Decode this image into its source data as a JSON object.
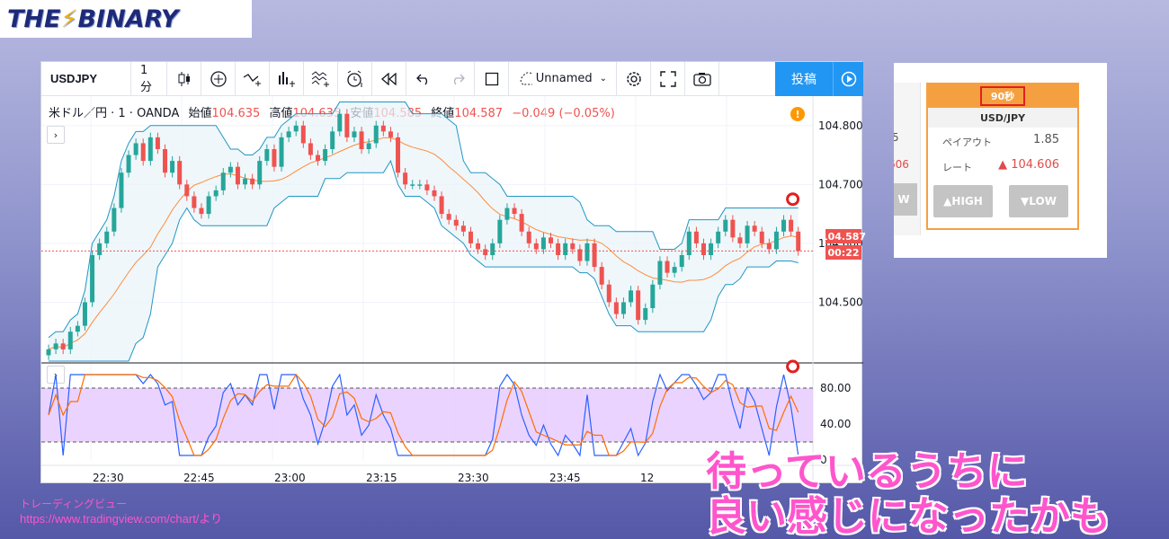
{
  "logo": {
    "text_a": "THE",
    "text_b": "BINARY"
  },
  "toolbar": {
    "symbol": "USDJPY",
    "interval": "1分",
    "layout_name": "Unnamed",
    "publish_label": "投稿"
  },
  "legend": {
    "title": "米ドル／円 · 1 · OANDA",
    "open_label": "始値",
    "open": "104.635",
    "high_label": "高値",
    "high": "104.635",
    "low_label": "安値",
    "low": "104.585",
    "close_label": "終値",
    "close": "104.587",
    "change": "−0.049 (−0.05%)"
  },
  "price_axis": {
    "labels": [
      "104.800",
      "104.700",
      "104.600",
      "104.500"
    ],
    "current_price": "104.587",
    "countdown": "00:22"
  },
  "osc_axis": {
    "labels": [
      "80.00",
      "40.00",
      "0"
    ]
  },
  "time_axis": {
    "labels": [
      "22:30",
      "22:45",
      "23:00",
      "23:15",
      "23:30",
      "23:45",
      "12"
    ]
  },
  "colors": {
    "up": "#26a69a",
    "down": "#ef5350",
    "band": "#2196c4",
    "basis": "#ff8c3a",
    "osc_fill": "#e6c8ff",
    "accent": "#2196f3",
    "caption": "#ff55cc",
    "widget_orange": "#f5a040"
  },
  "widget": {
    "timer": "90秒",
    "pair": "USD/JPY",
    "payout_label": "ペイアウト",
    "payout": "1.85",
    "rate_label": "レート",
    "rate": "▲ 104.606",
    "high_btn": "▲HIGH",
    "low_btn": "▼LOW",
    "partial_payout": "5",
    "partial_rate": "606",
    "partial_btn": "W"
  },
  "caption": {
    "line1": "待っているうちに",
    "line2": "良い感じになったかも"
  },
  "credit": {
    "line1": "トレーディングビュー",
    "line2": "https://www.tradingview.com/chart/より"
  },
  "chart_data": {
    "type": "candlestick",
    "symbol": "USDJPY",
    "interval": "1",
    "y_range": [
      104.4,
      104.85
    ],
    "x_ticks": [
      "22:30",
      "22:45",
      "23:00",
      "23:15",
      "23:30",
      "23:45",
      "12"
    ],
    "closes": [
      104.42,
      104.43,
      104.42,
      104.45,
      104.46,
      104.5,
      104.58,
      104.6,
      104.62,
      104.66,
      104.72,
      104.75,
      104.77,
      104.74,
      104.78,
      104.76,
      104.72,
      104.74,
      104.7,
      104.68,
      104.66,
      104.65,
      104.68,
      104.69,
      104.72,
      104.73,
      104.7,
      104.71,
      104.7,
      104.74,
      104.76,
      104.73,
      104.78,
      104.79,
      104.8,
      104.77,
      104.75,
      104.74,
      104.76,
      104.79,
      104.82,
      104.78,
      104.79,
      104.76,
      104.77,
      104.8,
      104.79,
      104.78,
      104.72,
      104.7,
      104.7,
      104.7,
      104.69,
      104.68,
      104.65,
      104.64,
      104.63,
      104.62,
      104.6,
      104.59,
      104.58,
      104.6,
      104.64,
      104.66,
      104.65,
      104.62,
      104.6,
      104.59,
      104.61,
      104.6,
      104.58,
      104.6,
      104.59,
      104.57,
      104.6,
      104.56,
      104.53,
      104.5,
      104.48,
      104.5,
      104.52,
      104.47,
      104.49,
      104.53,
      104.57,
      104.55,
      104.56,
      104.58,
      104.62,
      104.6,
      104.58,
      104.6,
      104.62,
      104.64,
      104.61,
      104.6,
      104.63,
      104.62,
      104.6,
      104.59,
      104.62,
      104.64,
      104.62,
      104.587
    ]
  }
}
